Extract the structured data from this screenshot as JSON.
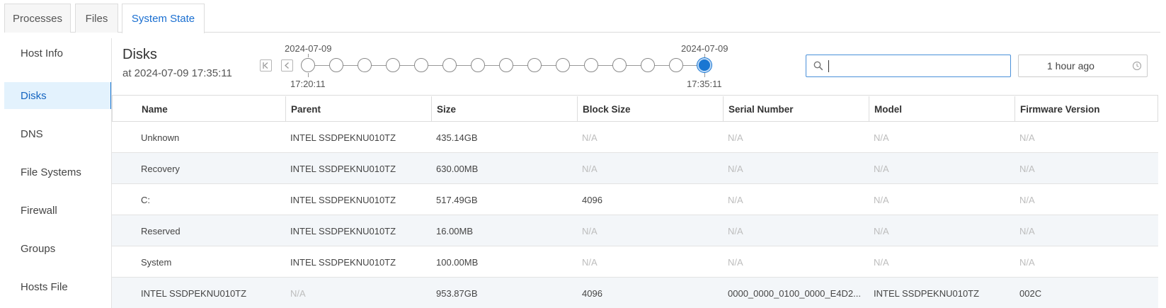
{
  "tabs": [
    {
      "label": "Processes"
    },
    {
      "label": "Files"
    },
    {
      "label": "System State"
    }
  ],
  "sidebar": {
    "items": [
      {
        "label": "Host Info"
      },
      {
        "label": "Disks"
      },
      {
        "label": "DNS"
      },
      {
        "label": "File Systems"
      },
      {
        "label": "Firewall"
      },
      {
        "label": "Groups"
      },
      {
        "label": "Hosts File"
      }
    ],
    "active": "Disks"
  },
  "header": {
    "title": "Disks",
    "subtitle": "at 2024-07-09 17:35:11"
  },
  "timeline": {
    "start_date": "2024-07-09",
    "start_time": "17:20:11",
    "end_date": "2024-07-09",
    "end_time": "17:35:11",
    "point_count": 15,
    "selected_index": 14
  },
  "search": {
    "value": "",
    "placeholder": "",
    "icon": "search-icon"
  },
  "time_filter": {
    "value": "1 hour ago",
    "icon": "clock-icon"
  },
  "table": {
    "columns": [
      "Name",
      "Parent",
      "Size",
      "Block Size",
      "Serial Number",
      "Model",
      "Firmware Version"
    ],
    "rows": [
      [
        "Unknown",
        "INTEL SSDPEKNU010TZ",
        "435.14GB",
        "N/A",
        "N/A",
        "N/A",
        "N/A"
      ],
      [
        "Recovery",
        "INTEL SSDPEKNU010TZ",
        "630.00MB",
        "N/A",
        "N/A",
        "N/A",
        "N/A"
      ],
      [
        "C:",
        "INTEL SSDPEKNU010TZ",
        "517.49GB",
        "4096",
        "N/A",
        "N/A",
        "N/A"
      ],
      [
        "Reserved",
        "INTEL SSDPEKNU010TZ",
        "16.00MB",
        "N/A",
        "N/A",
        "N/A",
        "N/A"
      ],
      [
        "System",
        "INTEL SSDPEKNU010TZ",
        "100.00MB",
        "N/A",
        "N/A",
        "N/A",
        "N/A"
      ],
      [
        "INTEL SSDPEKNU010TZ",
        "N/A",
        "953.87GB",
        "4096",
        "0000_0000_0100_0000_E4D2...",
        "INTEL SSDPEKNU010TZ",
        "002C"
      ]
    ]
  },
  "colors": {
    "accent": "#1976d2",
    "active_bg": "#e3f2fd",
    "row_alt": "#f3f6f9",
    "na_text": "#bdbdbd"
  }
}
